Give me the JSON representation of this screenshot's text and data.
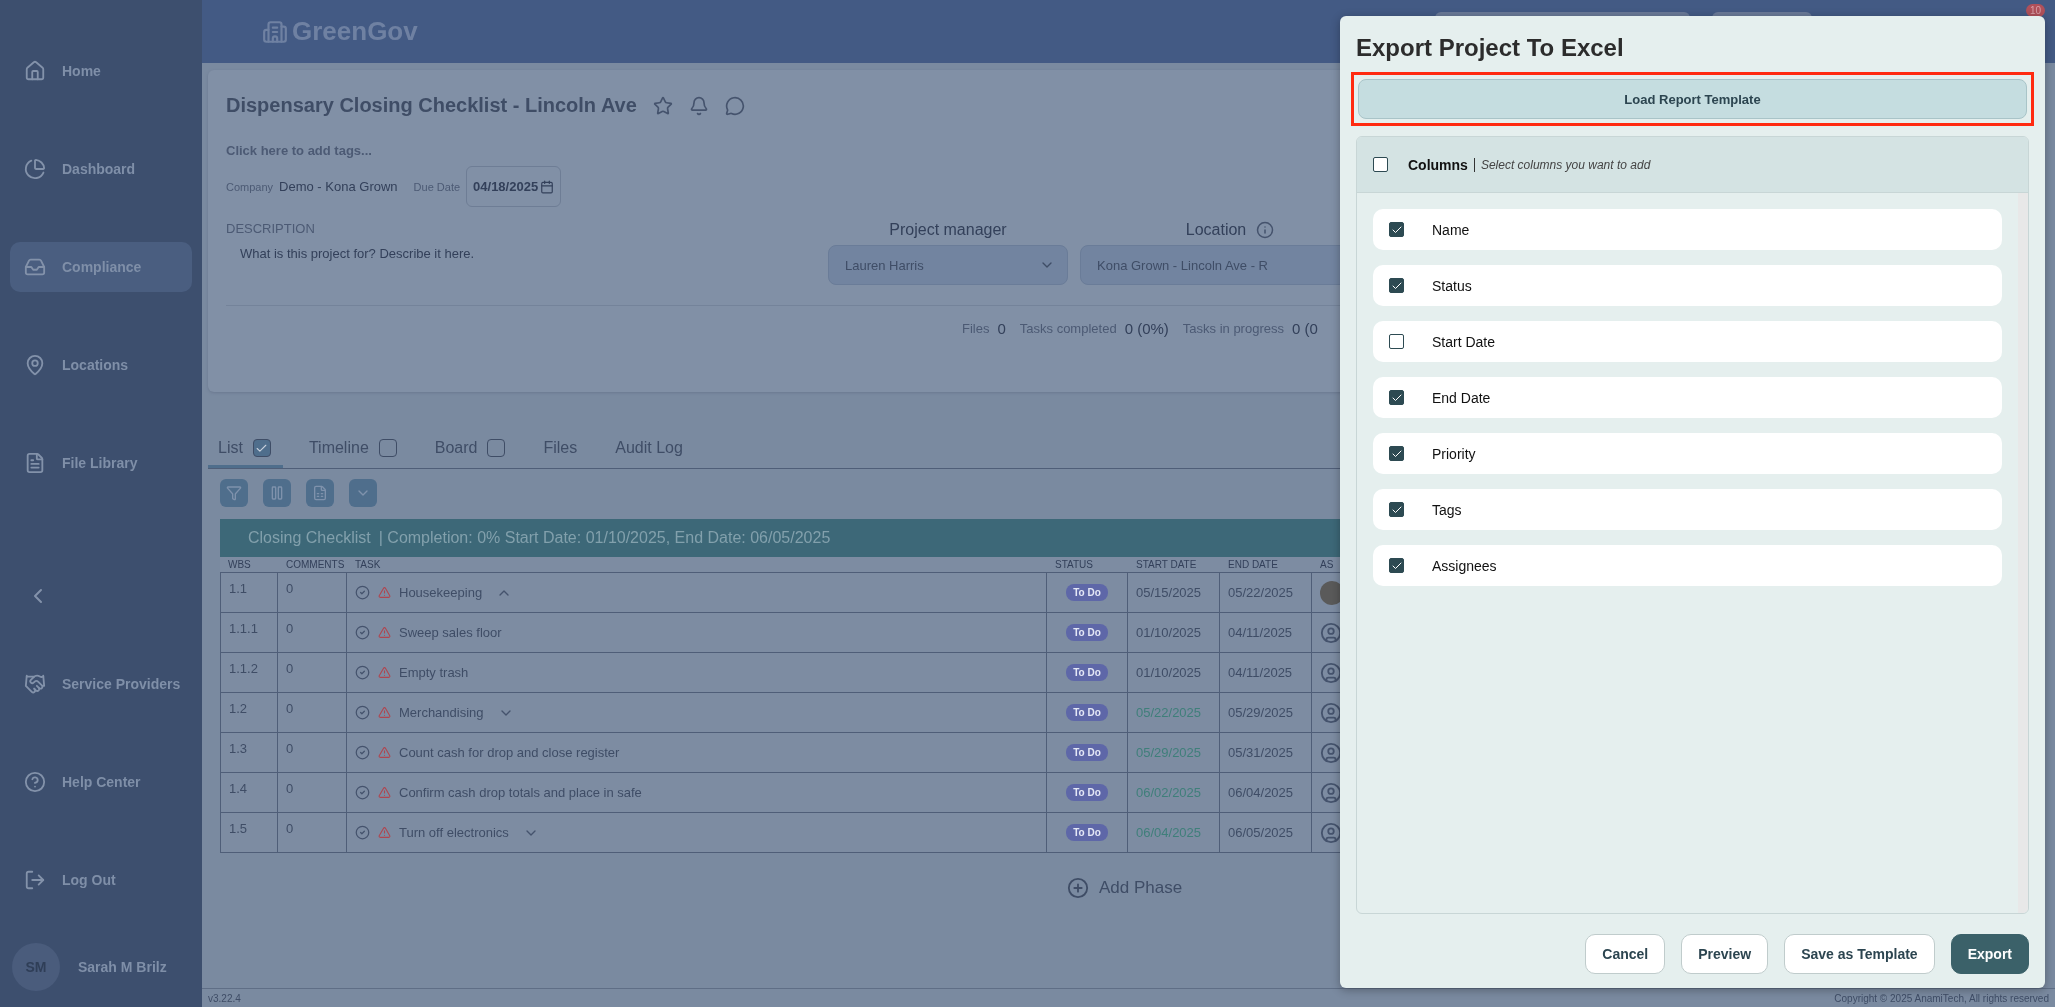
{
  "sidebar": {
    "items": [
      {
        "label": "Home",
        "selected": false
      },
      {
        "label": "Dashboard",
        "selected": false
      },
      {
        "label": "Compliance",
        "selected": true
      },
      {
        "label": "Locations",
        "selected": false
      },
      {
        "label": "File Library",
        "selected": false
      }
    ],
    "bottom_items": [
      {
        "label": "Service Providers"
      },
      {
        "label": "Help Center"
      },
      {
        "label": "Log Out"
      }
    ],
    "user": {
      "initials": "SM",
      "name": "Sarah M Brilz"
    }
  },
  "header": {
    "logo": "GreenGov",
    "badge": "10"
  },
  "project": {
    "title": "Dispensary Closing Checklist - Lincoln Ave",
    "tags_placeholder": "Click here to add tags...",
    "company_label": "Company",
    "company": "Demo - Kona Grown",
    "due_label": "Due Date",
    "due_date": "04/18/2025",
    "description_label": "DESCRIPTION",
    "description_placeholder": "What is this project for? Describe it here.",
    "manager_label": "Project manager",
    "manager": "Lauren Harris",
    "location_label": "Location",
    "location": "Kona Grown - Lincoln Ave - R",
    "stats": [
      {
        "label": "Files",
        "value": "0"
      },
      {
        "label": "Tasks completed",
        "value": "0 (0%)"
      },
      {
        "label": "Tasks in progress",
        "value": "0 (0"
      }
    ]
  },
  "tabs": [
    {
      "label": "List",
      "kind": "check",
      "checked": true,
      "selected": true
    },
    {
      "label": "Timeline",
      "kind": "check",
      "checked": false,
      "selected": false
    },
    {
      "label": "Board",
      "kind": "check",
      "checked": false,
      "selected": false
    },
    {
      "label": "Files",
      "kind": "plain",
      "selected": false
    },
    {
      "label": "Audit Log",
      "kind": "plain",
      "selected": false
    }
  ],
  "phase": {
    "name": "Closing Checklist",
    "summary": "| Completion: 0%  Start Date: 01/10/2025, End Date: 06/05/2025",
    "columns": [
      "WBS",
      "COMMENTS",
      "TASK",
      "STATUS",
      "START DATE",
      "END DATE",
      "AS"
    ],
    "rows": [
      {
        "wbs": "1.1",
        "comments": "0",
        "task": "Housekeeping",
        "kind": "group",
        "expanded": true,
        "status": "To Do",
        "start": "05/15/2025",
        "start_due": false,
        "end": "05/22/2025",
        "assigned": true
      },
      {
        "wbs": "1.1.1",
        "comments": "0",
        "task": "Sweep sales floor",
        "kind": "task",
        "status": "To Do",
        "start": "01/10/2025",
        "start_due": false,
        "end": "04/11/2025",
        "assigned": false
      },
      {
        "wbs": "1.1.2",
        "comments": "0",
        "task": "Empty trash",
        "kind": "task",
        "status": "To Do",
        "start": "01/10/2025",
        "start_due": false,
        "end": "04/11/2025",
        "assigned": false
      },
      {
        "wbs": "1.2",
        "comments": "0",
        "task": "Merchandising",
        "kind": "group",
        "expanded": false,
        "status": "To Do",
        "start": "05/22/2025",
        "start_due": true,
        "end": "05/29/2025",
        "assigned": false
      },
      {
        "wbs": "1.3",
        "comments": "0",
        "task": "Count cash for drop and close register",
        "kind": "task",
        "status": "To Do",
        "start": "05/29/2025",
        "start_due": true,
        "end": "05/31/2025",
        "assigned": false
      },
      {
        "wbs": "1.4",
        "comments": "0",
        "task": "Confirm cash drop totals and place in safe",
        "kind": "task",
        "status": "To Do",
        "start": "06/02/2025",
        "start_due": true,
        "end": "06/04/2025",
        "assigned": false
      },
      {
        "wbs": "1.5",
        "comments": "0",
        "task": "Turn off electronics",
        "kind": "group",
        "expanded": false,
        "status": "To Do",
        "start": "06/04/2025",
        "start_due": true,
        "end": "06/05/2025",
        "assigned": false
      }
    ]
  },
  "add_phase": "Add Phase",
  "footer": {
    "version": "v3.22.4",
    "copyright": "Copyright © 2025 AnamiTech, All rights reserved"
  },
  "dialog": {
    "title": "Export Project To Excel",
    "load_button": "Load Report Template",
    "highlighted": true,
    "columns_header": {
      "label": "Columns",
      "hint": "Select columns you want to add",
      "checked": false
    },
    "columns": [
      {
        "label": "Name",
        "checked": true
      },
      {
        "label": "Status",
        "checked": true
      },
      {
        "label": "Start Date",
        "checked": false
      },
      {
        "label": "End Date",
        "checked": true
      },
      {
        "label": "Priority",
        "checked": true
      },
      {
        "label": "Tags",
        "checked": true
      },
      {
        "label": "Assignees",
        "checked": true
      }
    ],
    "buttons": [
      {
        "label": "Cancel",
        "kind": "outline"
      },
      {
        "label": "Preview",
        "kind": "outline"
      },
      {
        "label": "Save as Template",
        "kind": "outline"
      },
      {
        "label": "Export",
        "kind": "primary"
      }
    ]
  }
}
